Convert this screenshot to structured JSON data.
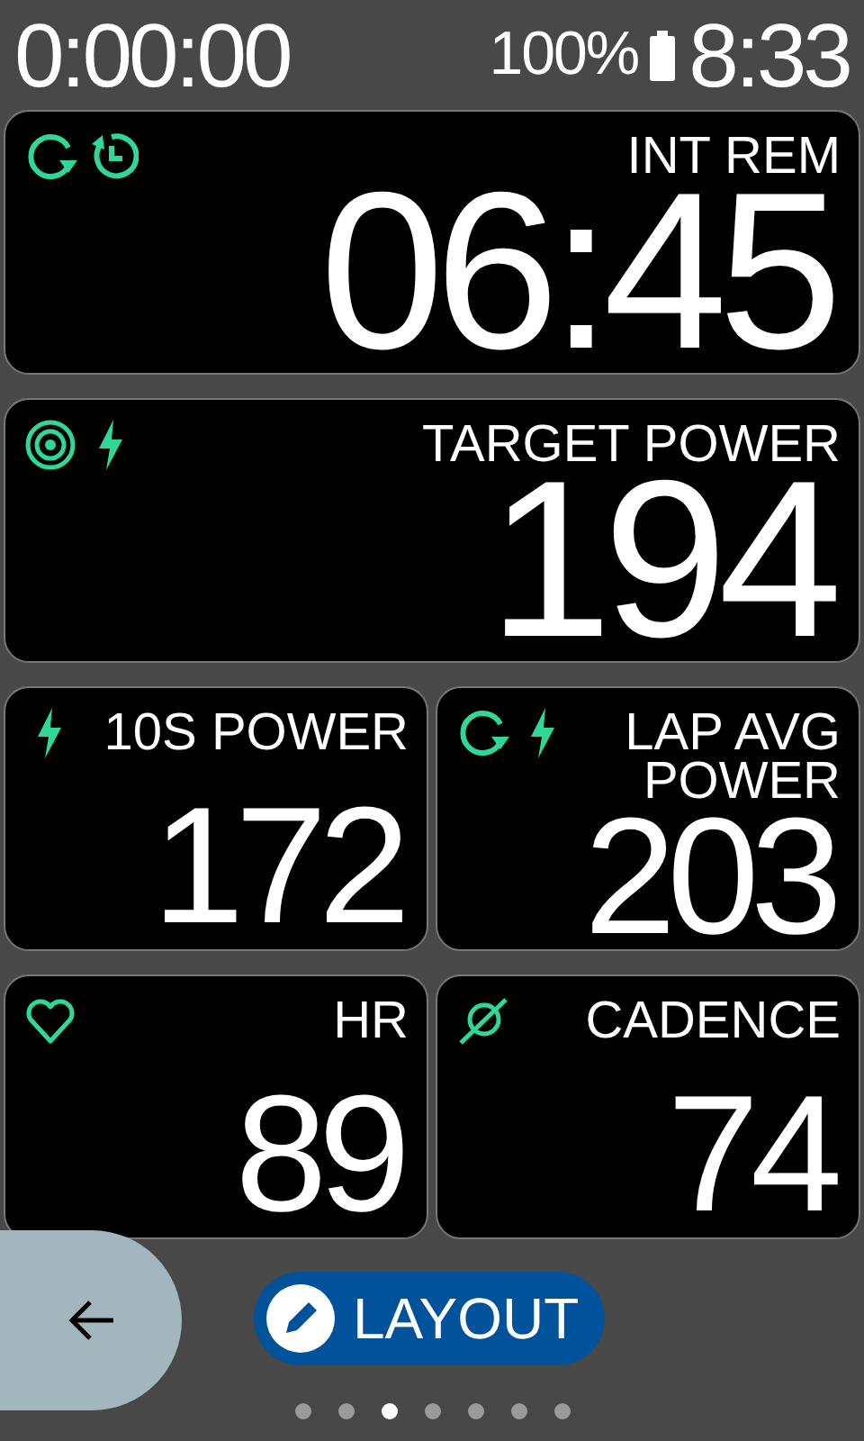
{
  "status_bar": {
    "elapsed": "0:00:00",
    "battery": "100%",
    "clock": "8:33"
  },
  "fields": [
    {
      "kind": "wide",
      "label": "INT REM",
      "value": "06:45",
      "icons": [
        {
          "kind": "lap"
        },
        {
          "kind": "timer"
        }
      ]
    },
    {
      "kind": "wide",
      "label": "TARGET POWER",
      "value": "194",
      "icons": [
        {
          "kind": "target"
        },
        {
          "kind": "power"
        }
      ]
    },
    {
      "kind": "narrow",
      "label": "10S POWER",
      "value": "172",
      "icons": [
        {
          "kind": "power"
        }
      ]
    },
    {
      "kind": "narrow",
      "label": "LAP AVG POWER",
      "value": "203",
      "icons": [
        {
          "kind": "lap"
        },
        {
          "kind": "power"
        }
      ]
    },
    {
      "kind": "narrow",
      "label": "HR",
      "value": "89",
      "icons": [
        {
          "kind": "heart"
        }
      ]
    },
    {
      "kind": "narrow",
      "label": "CADENCE",
      "value": "74",
      "icons": [
        {
          "kind": "cadence"
        }
      ]
    }
  ],
  "layout_button": {
    "label": "LAYOUT"
  },
  "pages": [
    {
      "selected": false
    },
    {
      "selected": false
    },
    {
      "selected": true
    },
    {
      "selected": false
    },
    {
      "selected": false
    },
    {
      "selected": false
    },
    {
      "selected": false
    }
  ]
}
